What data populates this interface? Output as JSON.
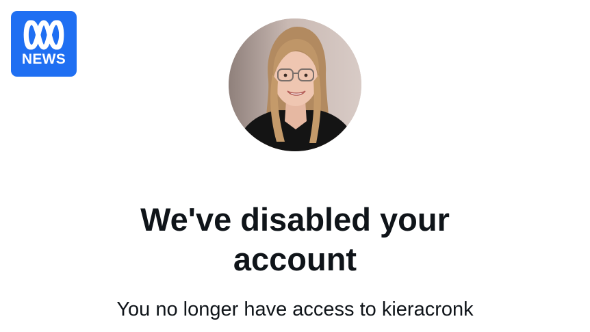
{
  "logo": {
    "text": "NEWS",
    "background_color": "#1f6ff2"
  },
  "avatar": {
    "icon": "profile-photo"
  },
  "message": {
    "title": "We've disabled your account",
    "subtitle": "You no longer have access to kieracronk"
  }
}
